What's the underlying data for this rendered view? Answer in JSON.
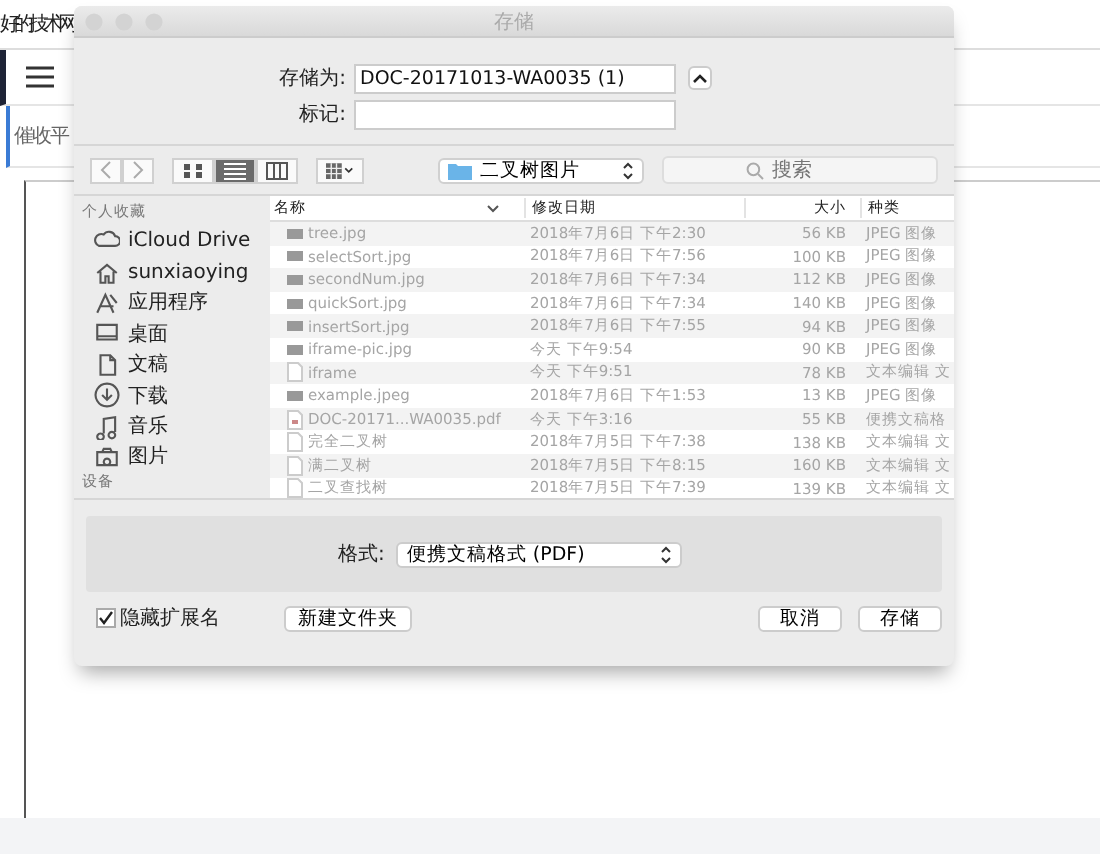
{
  "page": {
    "site_title": "好的技术网",
    "heading": "催收平"
  },
  "dialog": {
    "title": "存储",
    "save_as": {
      "label": "存储为:",
      "value": "DOC-20171013-WA0035 (1)"
    },
    "tags": {
      "label": "标记:"
    },
    "location": "二叉树图片",
    "search": {
      "placeholder": "搜索"
    },
    "views": [
      {
        "selected": false
      },
      {
        "selected": true
      },
      {
        "selected": false
      }
    ],
    "sidebar": {
      "section": "个人收藏",
      "items": [
        {
          "label": "iCloud Drive"
        },
        {
          "label": "sunxiaoying"
        },
        {
          "label": "应用程序"
        },
        {
          "label": "桌面"
        },
        {
          "label": "文稿"
        },
        {
          "label": "下载"
        },
        {
          "label": "音乐"
        },
        {
          "label": "图片"
        }
      ],
      "section_2": "设备"
    },
    "columns": [
      "名称",
      "修改日期",
      "大小",
      "种类"
    ],
    "files": [
      {
        "kind": "image",
        "name": "tree.jpg",
        "date": "2018年7月6日 下午2:30",
        "size": "56 KB",
        "type": "JPEG 图像"
      },
      {
        "kind": "image",
        "name": "selectSort.jpg",
        "date": "2018年7月6日 下午7:56",
        "size": "100 KB",
        "type": "JPEG 图像"
      },
      {
        "kind": "image",
        "name": "secondNum.jpg",
        "date": "2018年7月6日 下午7:34",
        "size": "112 KB",
        "type": "JPEG 图像"
      },
      {
        "kind": "image",
        "name": "quickSort.jpg",
        "date": "2018年7月6日 下午7:34",
        "size": "140 KB",
        "type": "JPEG 图像"
      },
      {
        "kind": "image",
        "name": "insertSort.jpg",
        "date": "2018年7月6日 下午7:55",
        "size": "94 KB",
        "type": "JPEG 图像"
      },
      {
        "kind": "image",
        "name": "iframe-pic.jpg",
        "date": "今天 下午9:54",
        "size": "90 KB",
        "type": "JPEG 图像"
      },
      {
        "kind": "document",
        "name": "iframe",
        "date": "今天 下午9:51",
        "size": "78 KB",
        "type": "文本编辑 文"
      },
      {
        "kind": "image",
        "name": "example.jpeg",
        "date": "2018年7月6日 下午1:53",
        "size": "13 KB",
        "type": "JPEG 图像"
      },
      {
        "kind": "pdf",
        "name": "DOC-20171...WA0035.pdf",
        "date": "今天 下午3:16",
        "size": "55 KB",
        "type": "便携文稿格"
      },
      {
        "kind": "document",
        "name": "完全二叉树",
        "date": "2018年7月5日 下午7:38",
        "size": "138 KB",
        "type": "文本编辑 文"
      },
      {
        "kind": "document",
        "name": "满二叉树",
        "date": "2018年7月5日 下午8:15",
        "size": "160 KB",
        "type": "文本编辑 文"
      },
      {
        "kind": "document",
        "name": "二叉查找树",
        "date": "2018年7月5日 下午7:39",
        "size": "139 KB",
        "type": "文本编辑 文"
      }
    ],
    "format": {
      "label": "格式:",
      "value": "便携文稿格式 (PDF)"
    },
    "hide_extension": {
      "label": "隐藏扩展名",
      "checked": true
    },
    "buttons": {
      "new_folder": "新建文件夹",
      "cancel": "取消",
      "save": "存储"
    }
  }
}
